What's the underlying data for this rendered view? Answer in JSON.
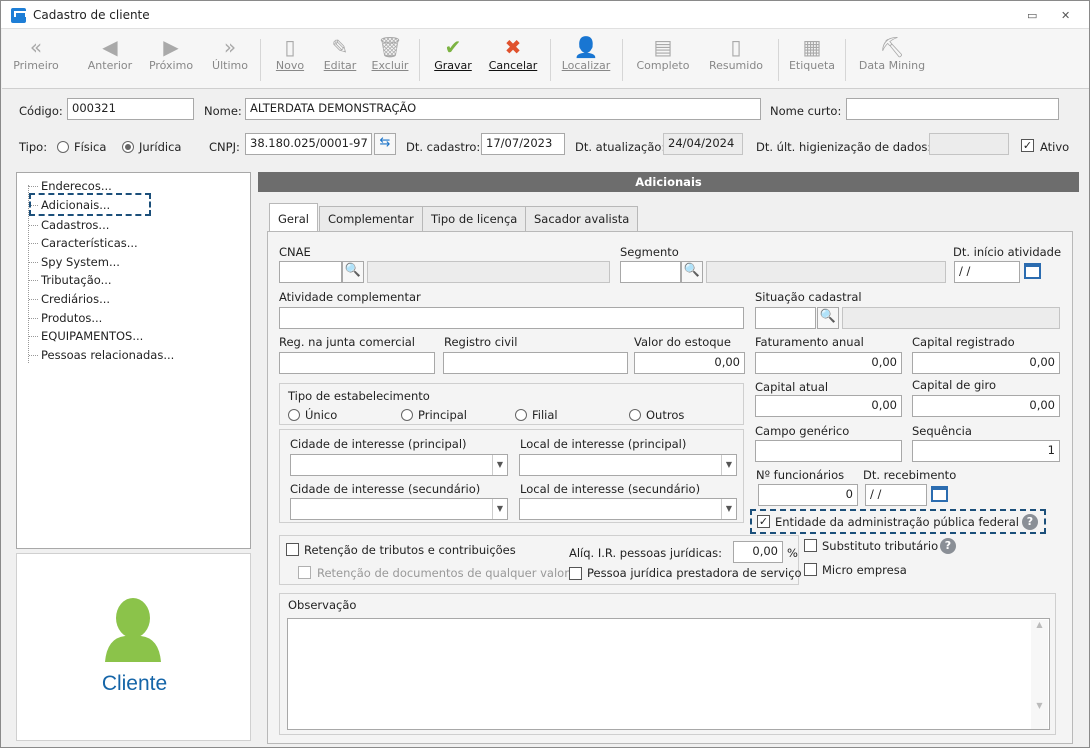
{
  "window": {
    "title": "Cadastro de cliente",
    "minimize": "▭",
    "close": "✕"
  },
  "toolbar": {
    "first": "Primeiro",
    "prev": "Anterior",
    "next": "Próximo",
    "last": "Último",
    "new": "Novo",
    "edit": "Editar",
    "delete": "Excluir",
    "save": "Gravar",
    "cancel": "Cancelar",
    "find": "Localizar",
    "full": "Completo",
    "summary": "Resumido",
    "label": "Etiqueta",
    "datamining": "Data Mining"
  },
  "header": {
    "code_label": "Código:",
    "code_value": "000321",
    "name_label": "Nome:",
    "name_value": "ALTERDATA DEMONSTRAÇÃO",
    "short_label": "Nome curto:",
    "short_value": "",
    "type_label": "Tipo:",
    "type_fisica": "Física",
    "type_juridica": "Jurídica",
    "cnpj_label": "CNPJ:",
    "cnpj_value": "38.180.025/0001-97",
    "dtcad_label": "Dt. cadastro:",
    "dtcad_value": "17/07/2023",
    "dtatu_label": "Dt. atualização:",
    "dtatu_value": "24/04/2024",
    "dthig_label": "Dt. últ. higienização de dados:",
    "dthig_value": "",
    "ativo_label": "Ativo"
  },
  "tree": {
    "items": [
      "Enderecos...",
      "Adicionais...",
      "Cadastros...",
      "Características...",
      "Spy System...",
      "Tributação...",
      "Crediários...",
      "Produtos...",
      "EQUIPAMENTOS...",
      "Pessoas relacionadas..."
    ]
  },
  "logo": {
    "label": "Cliente",
    "color": "#8bc34a"
  },
  "panel": {
    "title": "Adicionais"
  },
  "tabs": [
    "Geral",
    "Complementar",
    "Tipo de licença",
    "Sacador avalista"
  ],
  "form": {
    "cnae": "CNAE",
    "segmento": "Segmento",
    "dt_inicio": "Dt. início atividade",
    "dt_inicio_value": " / /",
    "atividade": "Atividade complementar",
    "situacao": "Situação cadastral",
    "reg_junta": "Reg. na junta comercial",
    "registro_civil": "Registro civil",
    "valor_estoque": "Valor do estoque",
    "valor_estoque_value": "0,00",
    "fat_anual": "Faturamento anual",
    "fat_anual_value": "0,00",
    "cap_reg": "Capital registrado",
    "cap_reg_value": "0,00",
    "cap_atual": "Capital atual",
    "cap_atual_value": "0,00",
    "cap_giro": "Capital de giro",
    "cap_giro_value": "0,00",
    "campo_gen": "Campo genérico",
    "sequencia": "Sequência",
    "sequencia_value": "1",
    "n_func": "Nº funcionários",
    "n_func_value": "0",
    "dt_receb": "Dt. recebimento",
    "dt_receb_value": " / /",
    "tipo_estab": "Tipo de estabelecimento",
    "estab_opts": [
      "Único",
      "Principal",
      "Filial",
      "Outros"
    ],
    "cid_int_p": "Cidade de interesse (principal)",
    "loc_int_p": "Local de interesse (principal)",
    "cid_int_s": "Cidade de interesse (secundário)",
    "loc_int_s": "Local de interesse (secundário)",
    "entidade": "Entidade da administração pública federal",
    "retencao": "Retenção de tributos e contribuições",
    "aliq": "Alíq. I.R. pessoas jurídicas:",
    "aliq_value": "0,00",
    "pct": "%",
    "subst": "Substituto tributário",
    "ret_docs": "Retenção de documentos de qualquer valor",
    "pj_prest": "Pessoa jurídica prestadora de serviço",
    "micro": "Micro empresa",
    "obs": "Observação"
  }
}
